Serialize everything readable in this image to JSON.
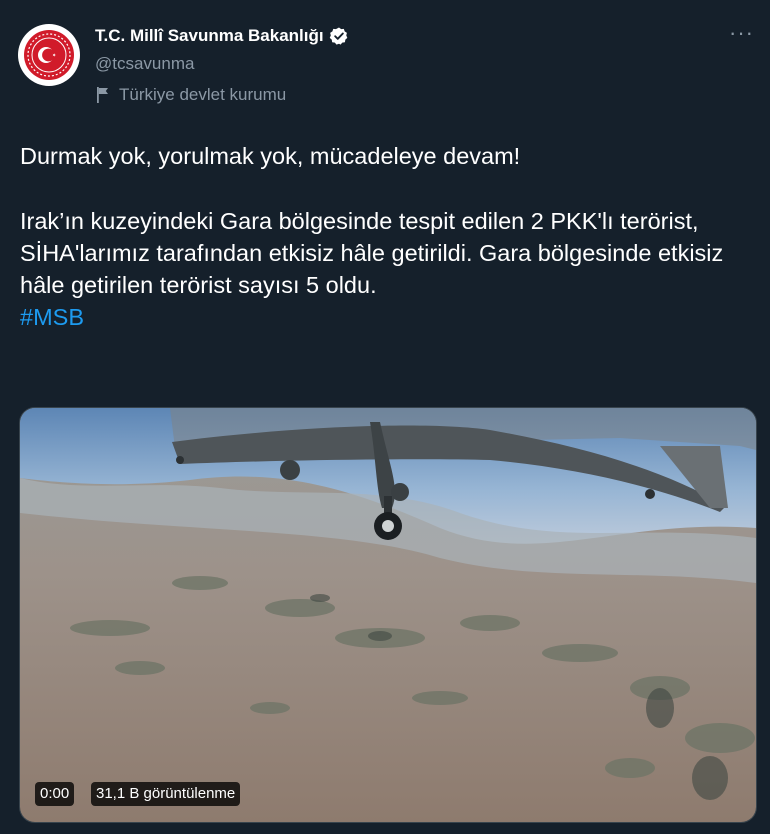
{
  "account": {
    "display_name": "T.C. Millî Savunma Bakanlığı",
    "handle": "@tcsavunma",
    "affiliation_label": "Türkiye devlet kurumu",
    "verified": true
  },
  "tweet": {
    "line1": "Durmak yok, yorulmak yok, mücadeleye devam!",
    "paragraph2": "Irak’ın kuzeyindeki Gara bölgesinde tespit edilen 2 PKK'lı terörist, SİHA'larımız tarafından etkisiz hâle getirildi. Gara bölgesinde etkisiz hâle getirilen terörist sayısı 5 oldu.",
    "hashtag": "#MSB"
  },
  "media": {
    "type": "video",
    "timestamp": "0:00",
    "view_count": "31,1 B görüntülenme"
  },
  "menu": {
    "more_label": "···"
  },
  "colors": {
    "background": "#15202b",
    "text": "#ffffff",
    "secondary_text": "#8b98a5",
    "link": "#1d9bf0",
    "verified_badge": "#ffffff",
    "avatar_red": "#d11b2a"
  },
  "icons": [
    "verified-badge-icon",
    "government-flag-icon",
    "more-options-icon",
    "ministry-seal-logo"
  ]
}
